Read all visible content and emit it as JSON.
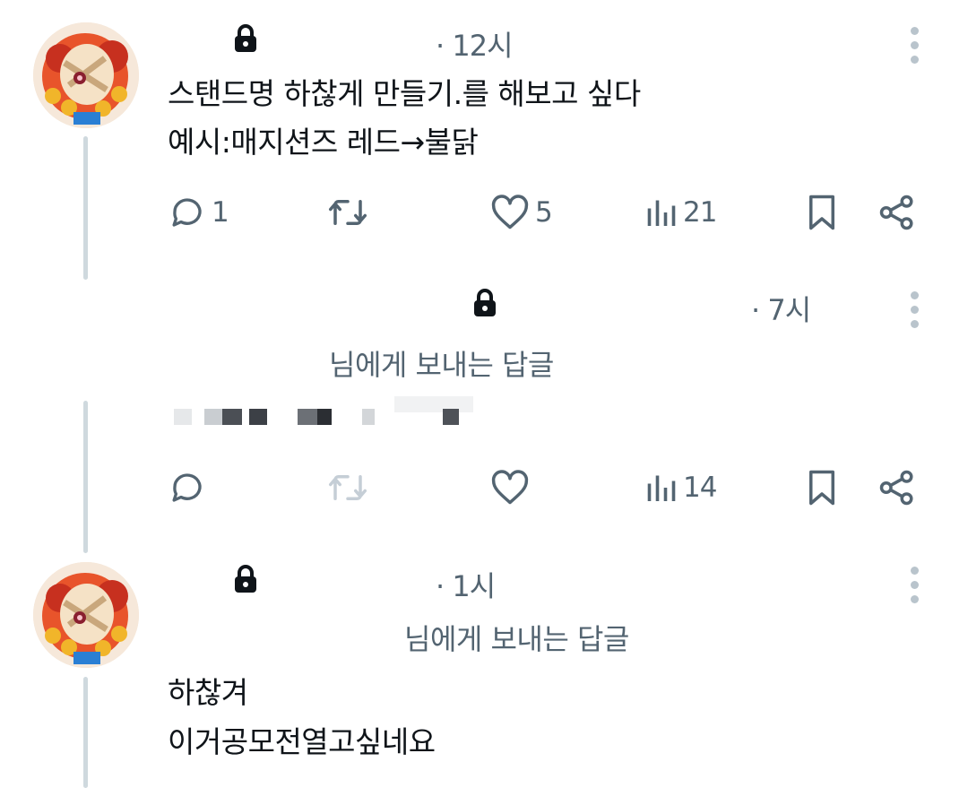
{
  "posts": [
    {
      "time": "· 12시",
      "lines": [
        "스탠드명 하찮게 만들기.를 해보고 싶다",
        "예시:매지션즈 레드→불닭"
      ],
      "actions": {
        "reply_count": "1",
        "like_count": "5",
        "view_count": "21"
      }
    },
    {
      "time": "· 7시",
      "reply_to": "님에게 보내는 답글",
      "actions": {
        "view_count": "14"
      }
    },
    {
      "time": "· 1시",
      "reply_to": "님에게 보내는 답글",
      "lines": [
        "하찮겨",
        "이거공모전열고싶네요"
      ]
    }
  ],
  "icons": [
    "lock-icon",
    "more-icon",
    "reply-icon",
    "repost-icon",
    "like-icon",
    "views-icon",
    "bookmark-icon",
    "share-icon"
  ],
  "colors": {
    "secondary_text": "#536471",
    "thread_line": "#cfd9de",
    "primary_text": "#0f1419"
  }
}
